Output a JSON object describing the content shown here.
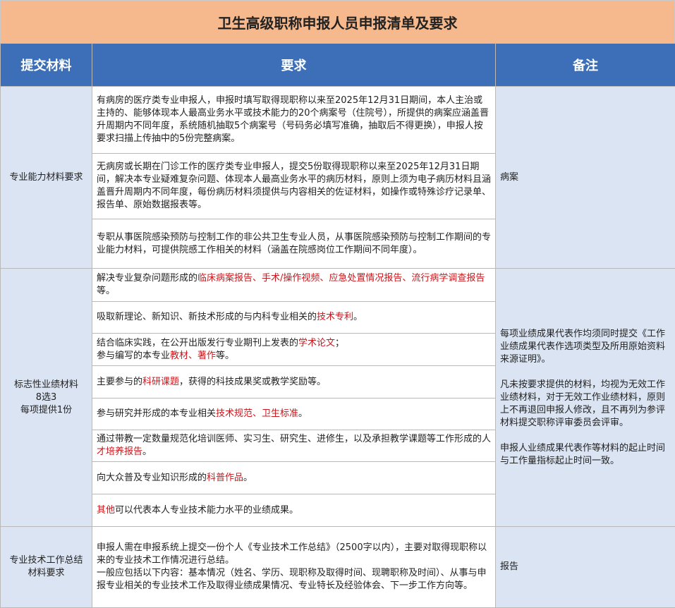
{
  "title": "卫生高级职称申报人员申报清单及要求",
  "headers": {
    "materials": "提交材料",
    "requirements": "要求",
    "notes": "备注"
  },
  "sections": [
    {
      "category_lines": [
        "专业能力材料要求"
      ],
      "note_lines": [
        "病案"
      ],
      "rows": [
        {
          "parts": [
            {
              "text": "有病房的医疗类专业申报人，申报时填写取得现职称以来至2025年12月31日期间，本人主治或主持的、能够体现本人最高业务水平或技术能力的20个病案号（住院号），所提供的病案应涵盖晋升周期内不同年度，系统随机抽取5个病案号（号码务必填写准确，抽取后不得更换），申报人按要求扫描上传抽中的5份完整病案。",
              "hl": false
            }
          ]
        },
        {
          "parts": [
            {
              "text": "无病房或长期在门诊工作的医疗类专业申报人，提交5份取得现职称以来至2025年12月31日期间，解决本专业疑难复杂问题、体现本人最高业务水平的病历材料，原则上须为电子病历材料且涵盖晋升周期内不同年度，每份病历材料须提供与内容相关的佐证材料，如操作或特殊诊疗记录单、报告单、原始数据报表等。",
              "hl": false
            }
          ]
        },
        {
          "parts": [
            {
              "text": "专职从事医院感染预防与控制工作的非公共卫生专业人员，从事医院感染预防与控制工作期间的专业能力材料，可提供院感工作相关的材料（涵盖在院感岗位工作期间不同年度）。",
              "hl": false
            }
          ]
        }
      ]
    },
    {
      "category_lines": [
        "标志性业绩材料",
        "8选3",
        "每项提供1份"
      ],
      "note_paragraphs": [
        "每项业绩成果代表作均须同时提交《工作业绩成果代表作选项类型及所用原始资料来源证明》。",
        "凡未按要求提供的材料，均视为无效工作业绩材料，对于无效工作业绩材料，原则上不再退回申报人修改，且不再列为参评材料提交职称评审委员会评审。",
        "申报人业绩成果代表作等材料的起止时间与工作量指标起止时间一致。"
      ],
      "rows": [
        {
          "parts": [
            {
              "text": "解决专业复杂问题形成的",
              "hl": false
            },
            {
              "text": "临床病案报告、手术/操作视频、应急处置情况报告、流行病学调查报告",
              "hl": true
            },
            {
              "text": "等。",
              "hl": false
            }
          ]
        },
        {
          "parts": [
            {
              "text": "吸取新理论、新知识、新技术形成的与内科专业相关的",
              "hl": false
            },
            {
              "text": "技术专利",
              "hl": true
            },
            {
              "text": "。",
              "hl": false
            }
          ]
        },
        {
          "parts": [
            {
              "text": "结合临床实践，在公开出版发行专业期刊上发表的",
              "hl": false
            },
            {
              "text": "学术论文",
              "hl": true
            },
            {
              "text": "；",
              "hl": false
            },
            {
              "br": true
            },
            {
              "text": "参与编写的本专业",
              "hl": false
            },
            {
              "text": "教材、著作",
              "hl": true
            },
            {
              "text": "等。",
              "hl": false
            }
          ]
        },
        {
          "parts": [
            {
              "text": "主要参与的",
              "hl": false
            },
            {
              "text": "科研课题",
              "hl": true
            },
            {
              "text": "，获得的科技成果奖或教学奖励等。",
              "hl": false
            }
          ]
        },
        {
          "parts": [
            {
              "text": "参与研究并形成的本专业相关",
              "hl": false
            },
            {
              "text": "技术规范、卫生标准",
              "hl": true
            },
            {
              "text": "。",
              "hl": false
            }
          ]
        },
        {
          "parts": [
            {
              "text": "通过带教一定数量规范化培训医师、实习生、研究生、进修生，以及承担教学课题等工作形成的人",
              "hl": false
            },
            {
              "text": "才培养报告",
              "hl": true
            },
            {
              "text": "。",
              "hl": false
            }
          ]
        },
        {
          "parts": [
            {
              "text": "向大众普及专业知识形成的",
              "hl": false
            },
            {
              "text": "科普作品",
              "hl": true
            },
            {
              "text": "。",
              "hl": false
            }
          ]
        },
        {
          "parts": [
            {
              "text": "其他",
              "hl": true
            },
            {
              "text": "可以代表本人专业技术能力水平的业绩成果。",
              "hl": false
            }
          ]
        }
      ]
    },
    {
      "category_lines": [
        "专业技术工作总结",
        "材料要求"
      ],
      "note_lines": [
        "报告"
      ],
      "rows": [
        {
          "parts": [
            {
              "text": "申报人需在申报系统上提交一份个人《专业技术工作总结》（2500字以内），主要对取得现职称以来的专业技术工作情况进行总结。",
              "hl": false
            },
            {
              "br": true
            },
            {
              "text": "一般应包括以下内容：基本情况（姓名、学历、现职称及取得时间、现聘职称及时间）、从事与申报专业相关的专业技术工作及取得业绩成果情况、专业特长及经验体会、下一步工作方向等。",
              "hl": false
            }
          ]
        }
      ]
    }
  ]
}
